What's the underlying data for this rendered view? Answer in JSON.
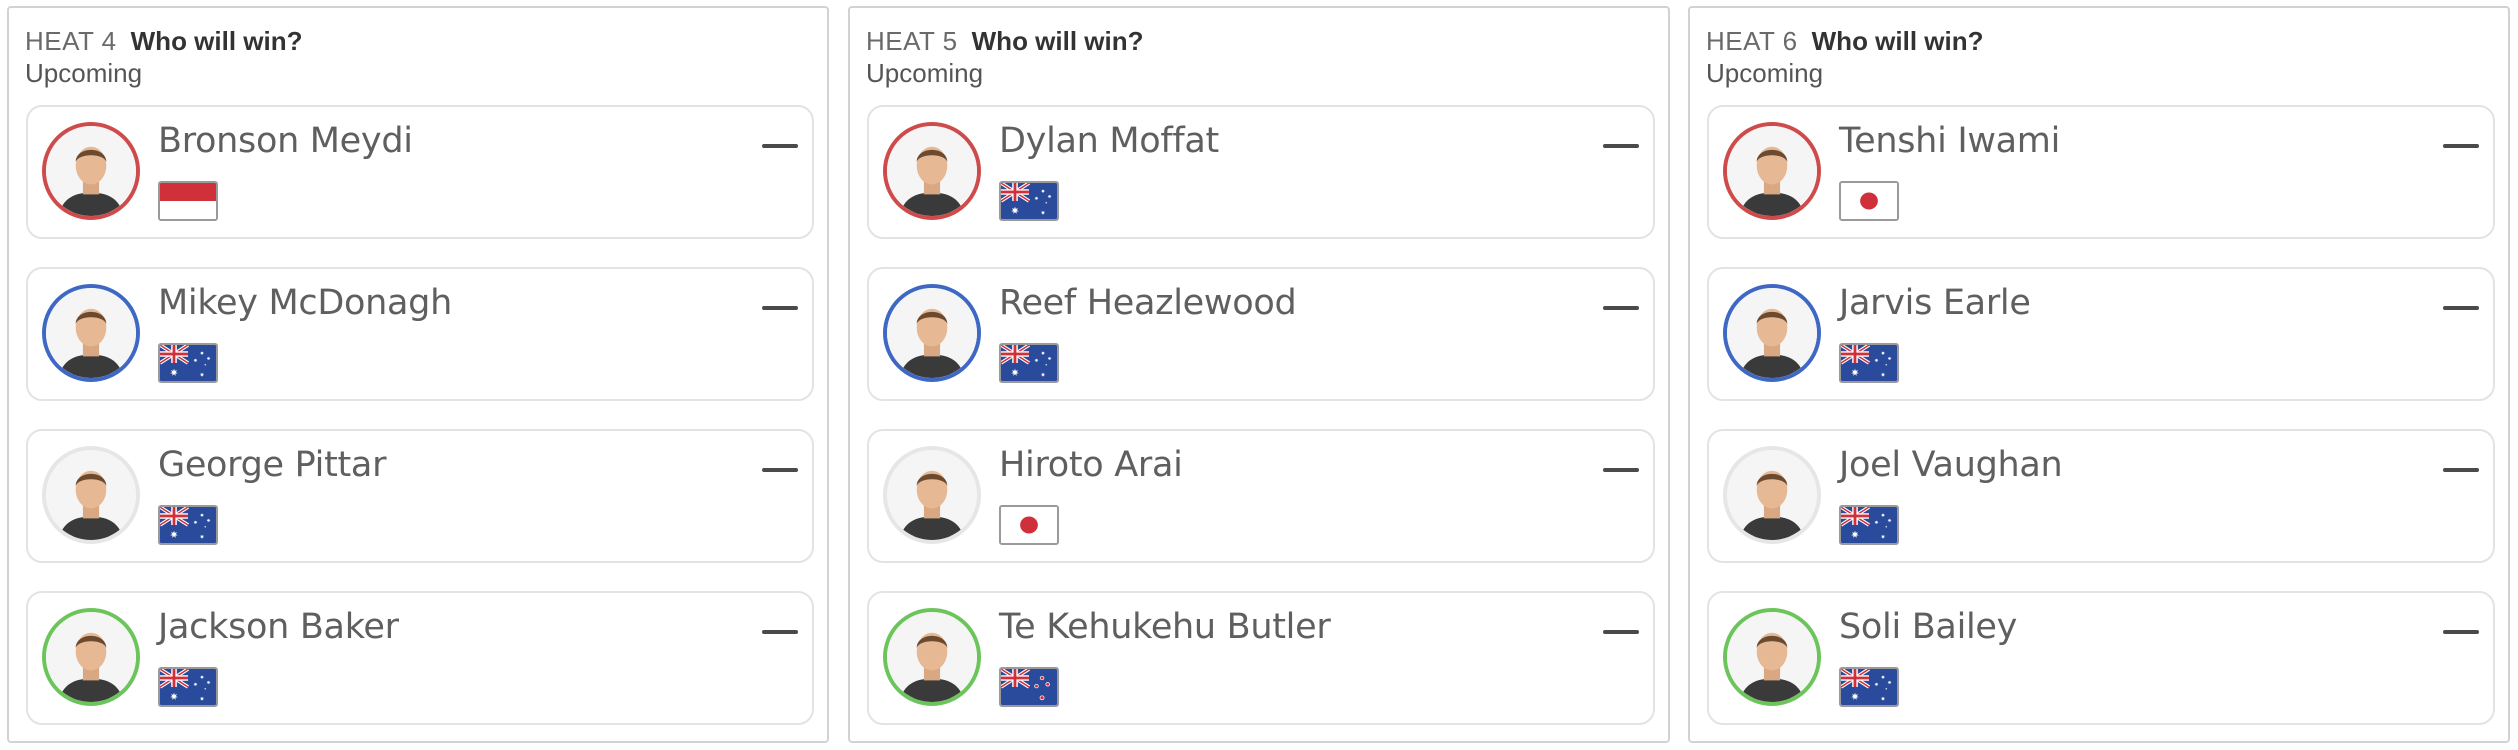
{
  "heats": [
    {
      "label": "HEAT 4",
      "question": "Who will win?",
      "status": "Upcoming",
      "surfers": [
        {
          "name": "Bronson Meydi",
          "flag": "indonesia-flag-icon",
          "jersey": "red"
        },
        {
          "name": "Mikey McDonagh",
          "flag": "australia-flag-icon",
          "jersey": "blue"
        },
        {
          "name": "George Pittar",
          "flag": "australia-flag-icon",
          "jersey": "white"
        },
        {
          "name": "Jackson Baker",
          "flag": "australia-flag-icon",
          "jersey": "green"
        }
      ]
    },
    {
      "label": "HEAT 5",
      "question": "Who will win?",
      "status": "Upcoming",
      "surfers": [
        {
          "name": "Dylan Moffat",
          "flag": "australia-flag-icon",
          "jersey": "red"
        },
        {
          "name": "Reef Heazlewood",
          "flag": "australia-flag-icon",
          "jersey": "blue"
        },
        {
          "name": "Hiroto Arai",
          "flag": "japan-flag-icon",
          "jersey": "white"
        },
        {
          "name": "Te Kehukehu Butler",
          "flag": "new-zealand-flag-icon",
          "jersey": "green"
        }
      ]
    },
    {
      "label": "HEAT 6",
      "question": "Who will win?",
      "status": "Upcoming",
      "surfers": [
        {
          "name": "Tenshi Iwami",
          "flag": "japan-flag-icon",
          "jersey": "red"
        },
        {
          "name": "Jarvis Earle",
          "flag": "australia-flag-icon",
          "jersey": "blue"
        },
        {
          "name": "Joel Vaughan",
          "flag": "australia-flag-icon",
          "jersey": "white"
        },
        {
          "name": "Soli Bailey",
          "flag": "australia-flag-icon",
          "jersey": "green"
        }
      ]
    }
  ],
  "colors": {
    "red": "#cf4a4a",
    "blue": "#3e68c4",
    "white": "#e6e6e6",
    "green": "#6cc55a",
    "flag_blue": "#2a4a9c",
    "flag_red": "#d0303a"
  }
}
